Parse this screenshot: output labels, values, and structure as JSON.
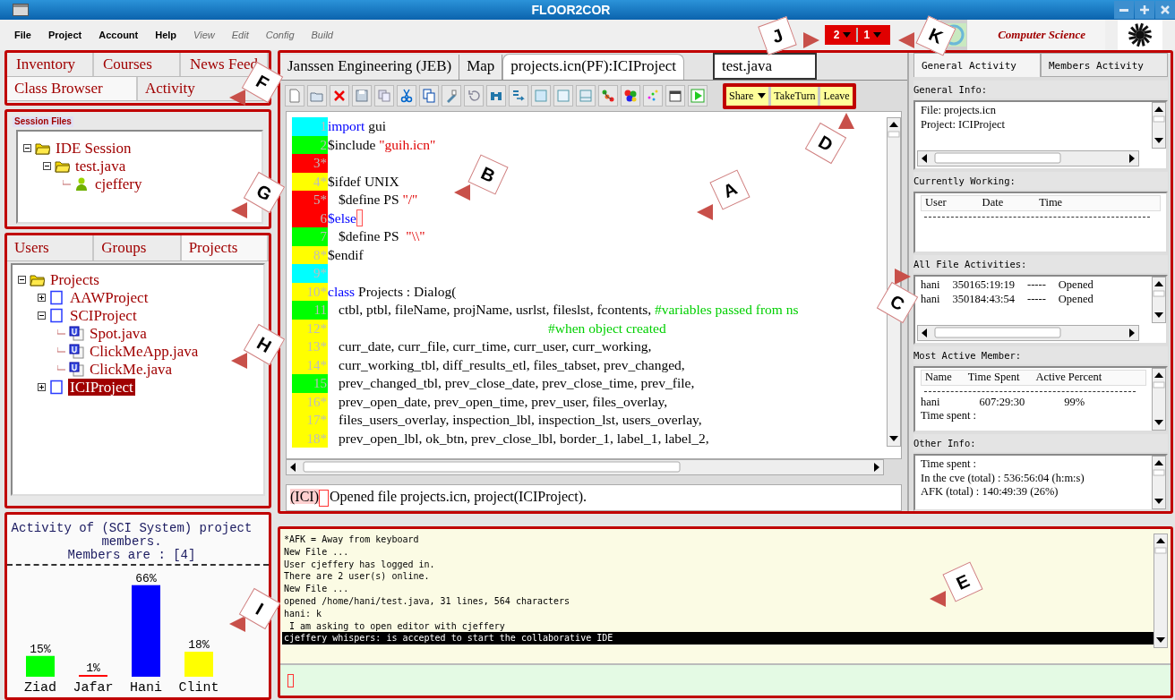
{
  "window": {
    "title": "FLOOR2COR"
  },
  "menu": [
    {
      "label": "File",
      "disabled": false
    },
    {
      "label": "Project",
      "disabled": false
    },
    {
      "label": "Account",
      "disabled": false
    },
    {
      "label": "Help",
      "disabled": false
    },
    {
      "label": "View",
      "disabled": true
    },
    {
      "label": "Edit",
      "disabled": true
    },
    {
      "label": "Config",
      "disabled": true
    },
    {
      "label": "Build",
      "disabled": true
    }
  ],
  "notifications": [
    {
      "count": "2"
    },
    {
      "count": "1"
    }
  ],
  "brand": {
    "text": "Computer Science"
  },
  "nav_tabs": [
    {
      "label": "Inventory",
      "selected": false
    },
    {
      "label": "Courses",
      "selected": false
    },
    {
      "label": "News Feed",
      "selected": false
    },
    {
      "label": "Class Browser",
      "selected": true
    },
    {
      "label": "Activity",
      "selected": false
    }
  ],
  "session_files": {
    "label": "Session Files",
    "tree": [
      {
        "label": "IDE Session",
        "kind": "folder",
        "expanded": true,
        "selected": false,
        "children": [
          {
            "label": "test.java",
            "kind": "folder",
            "expanded": true,
            "selected": false,
            "children": [
              {
                "label": "cjeffery",
                "kind": "user",
                "selected": false
              }
            ]
          }
        ]
      }
    ]
  },
  "browser": {
    "tabs": [
      {
        "label": "Users",
        "selected": false
      },
      {
        "label": "Groups",
        "selected": false
      },
      {
        "label": "Projects",
        "selected": true
      }
    ],
    "tree": [
      {
        "label": "Projects",
        "kind": "folder",
        "expanded": true,
        "selected": false,
        "children": [
          {
            "label": "AAWProject",
            "kind": "project",
            "expanded": false,
            "selected": false
          },
          {
            "label": "SCIProject",
            "kind": "project",
            "expanded": true,
            "selected": false,
            "children": [
              {
                "label": "Spot.java",
                "kind": "file",
                "selected": false
              },
              {
                "label": "ClickMeApp.java",
                "kind": "file",
                "selected": false
              },
              {
                "label": "ClickMe.java",
                "kind": "file",
                "selected": false
              }
            ]
          },
          {
            "label": "ICIProject",
            "kind": "project",
            "expanded": false,
            "selected": true
          }
        ]
      }
    ]
  },
  "activity_chart": {
    "chart_data": {
      "type": "bar",
      "title": "Activity of (SCI System) project members.",
      "subtitle": "Members are : [4]",
      "categories": [
        "Ziad",
        "Jafar",
        "Hani",
        "Clint"
      ],
      "values": [
        15,
        1,
        66,
        18
      ],
      "colors": [
        "#00ff00",
        "#ff0000",
        "#0000ff",
        "#ffff00"
      ],
      "data_labels": true,
      "value_labels": [
        "15%",
        "1%",
        "66%",
        "18%"
      ]
    }
  },
  "editor": {
    "tabs": [
      {
        "label": "Janssen Engineering (JEB)",
        "kind": "tab",
        "selected": false
      },
      {
        "label": "Map",
        "kind": "tab",
        "selected": false
      },
      {
        "label": "projects.icn(PF):ICIProject",
        "kind": "tab",
        "selected": true
      },
      {
        "label": "test.java",
        "kind": "framed",
        "selected": false
      }
    ],
    "share_buttons": [
      {
        "label": "Share",
        "kind": "dropdown"
      },
      {
        "label": "TakeTurn",
        "kind": "button"
      },
      {
        "label": "Leave",
        "kind": "button"
      }
    ],
    "lines": [
      {
        "number": "1",
        "color": "#00ffff",
        "segments": [
          {
            "kind": "keyword",
            "text": "import"
          },
          {
            "kind": "plain",
            "text": " gui"
          }
        ]
      },
      {
        "number": "2",
        "color": "#00ff00",
        "segments": [
          {
            "kind": "plain",
            "text": "$include "
          },
          {
            "kind": "string",
            "text": "\"guih.icn\""
          }
        ]
      },
      {
        "number": "3*",
        "color": "#ff0000"
      },
      {
        "number": "4*",
        "color": "#ffff00",
        "segments": [
          {
            "kind": "plain",
            "text": "$ifdef UNIX"
          }
        ]
      },
      {
        "number": "5*",
        "color": "#ff0000",
        "indented": true,
        "segments": [
          {
            "kind": "plain",
            "text": "$define PS "
          },
          {
            "kind": "string",
            "text": "\"/\""
          }
        ]
      },
      {
        "number": "6",
        "color": "#ff0000",
        "cursor": true,
        "segments": [
          {
            "kind": "keyword",
            "text": "$else"
          }
        ]
      },
      {
        "number": "7",
        "color": "#00ff00",
        "indented": true,
        "segments": [
          {
            "kind": "plain",
            "text": "$define PS  "
          },
          {
            "kind": "string",
            "text": "\"\\\\\""
          }
        ]
      },
      {
        "number": "8*",
        "color": "#ffff00",
        "segments": [
          {
            "kind": "plain",
            "text": "$endif"
          }
        ]
      },
      {
        "number": "9*",
        "color": "#00ffff"
      },
      {
        "number": "10*",
        "color": "#ffff00",
        "segments": [
          {
            "kind": "keyword",
            "text": "class"
          },
          {
            "kind": "plain",
            "text": " Projects : Dialog("
          }
        ]
      },
      {
        "number": "11",
        "color": "#00ff00",
        "indented": true,
        "segments": [
          {
            "kind": "plain",
            "text": "ctbl, ptbl, fileName, projName, usrlst, fileslst, fcontents, "
          },
          {
            "kind": "comment",
            "text": "#variables passed from ns"
          }
        ]
      },
      {
        "number": "12*",
        "color": "#ffff00",
        "continuation": true,
        "segments": [
          {
            "kind": "comment",
            "text": "#when object created"
          }
        ]
      },
      {
        "number": "13*",
        "color": "#ffff00",
        "indented": true,
        "segments": [
          {
            "kind": "plain",
            "text": "curr_date, curr_file, curr_time, curr_user, curr_working,"
          }
        ]
      },
      {
        "number": "14*",
        "color": "#ffff00",
        "indented": true,
        "segments": [
          {
            "kind": "plain",
            "text": "curr_working_tbl, diff_results_etl, files_tabset, prev_changed,"
          }
        ]
      },
      {
        "number": "15",
        "color": "#00ff00",
        "indented": true,
        "segments": [
          {
            "kind": "plain",
            "text": "prev_changed_tbl, prev_close_date, prev_close_time, prev_file,"
          }
        ]
      },
      {
        "number": "16*",
        "color": "#ffff00",
        "indented": true,
        "segments": [
          {
            "kind": "plain",
            "text": "prev_open_date, prev_open_time, prev_user, files_overlay,"
          }
        ]
      },
      {
        "number": "17*",
        "color": "#ffff00",
        "indented": true,
        "segments": [
          {
            "kind": "plain",
            "text": "files_users_overlay, inspection_lbl, inspection_lst, users_overlay,"
          }
        ]
      },
      {
        "number": "18*",
        "color": "#ffff00",
        "indented": true,
        "segments": [
          {
            "kind": "plain",
            "text": "prev_open_lbl, ok_btn, prev_close_lbl, border_1, label_1, label_2,"
          }
        ]
      }
    ],
    "status": {
      "prefix": "(ICI)",
      "message": "Opened file projects.icn, project(ICIProject)."
    }
  },
  "activity_panel": {
    "tabs": [
      {
        "label": "General Activity",
        "selected": true
      },
      {
        "label": "Members Activity",
        "selected": false
      }
    ],
    "sections": [
      {
        "heading": "General Info:",
        "kind": "list",
        "hscroll": true,
        "lines": [
          "File: projects.icn",
          "Project: ICIProject"
        ]
      },
      {
        "heading": "Currently Working:",
        "kind": "table",
        "hscroll": false,
        "columns": [
          "User",
          "Date",
          "Time"
        ]
      },
      {
        "heading": "All File Activities:",
        "kind": "table",
        "hscroll": true,
        "rows": [
          [
            "hani",
            "350165:19:19",
            "-----",
            "Opened"
          ],
          [
            "hani",
            "350184:43:54",
            "-----",
            "Opened"
          ]
        ]
      },
      {
        "heading": "Most Active Member:",
        "kind": "table",
        "hscroll": false,
        "columns": [
          "Name",
          "Time Spent",
          "Active Percent"
        ],
        "rows": [
          [
            "hani",
            "607:29:30",
            "99%"
          ]
        ],
        "notes": [
          "Time spent :"
        ]
      },
      {
        "heading": "Other Info:",
        "kind": "list",
        "hscroll": false,
        "lines": [
          "Time spent :",
          "In the cve (total) : 536:56:04 (h:m:s)",
          "AFK (total) : 140:49:39 (26%)"
        ]
      }
    ]
  },
  "console": {
    "lines": [
      {
        "text": "*AFK = Away from keyboard",
        "selected": false
      },
      {
        "text": "New File ...",
        "selected": false
      },
      {
        "text": "User cjeffery has logged in.",
        "selected": false
      },
      {
        "text": "There are 2 user(s) online.",
        "selected": false
      },
      {
        "text": "New File ...",
        "selected": false
      },
      {
        "text": "opened /home/hani/test.java, 31 lines, 564 characters",
        "selected": false
      },
      {
        "text": "hani: k",
        "selected": false
      },
      {
        "text": " I am asking to open editor with cjeffery",
        "selected": false
      },
      {
        "text": "cjeffery whispers: is accepted to start the collaborative IDE",
        "selected": true
      }
    ]
  },
  "callouts": [
    {
      "label": "J"
    },
    {
      "label": "K"
    },
    {
      "label": "F"
    },
    {
      "label": "D"
    },
    {
      "label": "B"
    },
    {
      "label": "A"
    },
    {
      "label": "G"
    },
    {
      "label": "C"
    },
    {
      "label": "H"
    },
    {
      "label": "I"
    },
    {
      "label": "E"
    }
  ]
}
